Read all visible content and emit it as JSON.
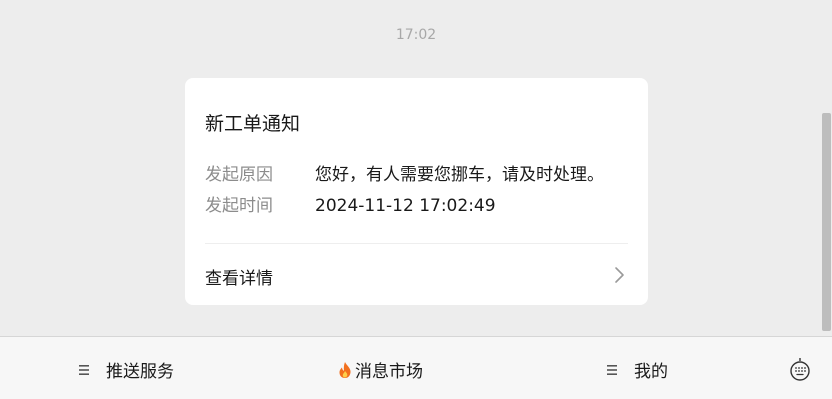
{
  "chat": {
    "timestamp": "17:02"
  },
  "card": {
    "title": "新工单通知",
    "fields": [
      {
        "label": "发起原因",
        "value": "您好，有人需要您挪车，请及时处理。"
      },
      {
        "label": "发起时间",
        "value": "2024-11-12 17:02:49"
      }
    ],
    "link_label": "查看详情",
    "link_icon": "chevron-right-icon"
  },
  "menu": {
    "items": [
      {
        "label": "推送服务",
        "icon": "menu-lines-icon"
      },
      {
        "label": "消息市场",
        "icon": "flame-icon"
      },
      {
        "label": "我的",
        "icon": "menu-lines-icon"
      }
    ],
    "keyboard_icon": "keyboard-icon"
  },
  "colors": {
    "background": "#ededed",
    "card": "#ffffff",
    "label": "#8c8c8c",
    "text": "#191919",
    "flame": "#f2701f"
  }
}
